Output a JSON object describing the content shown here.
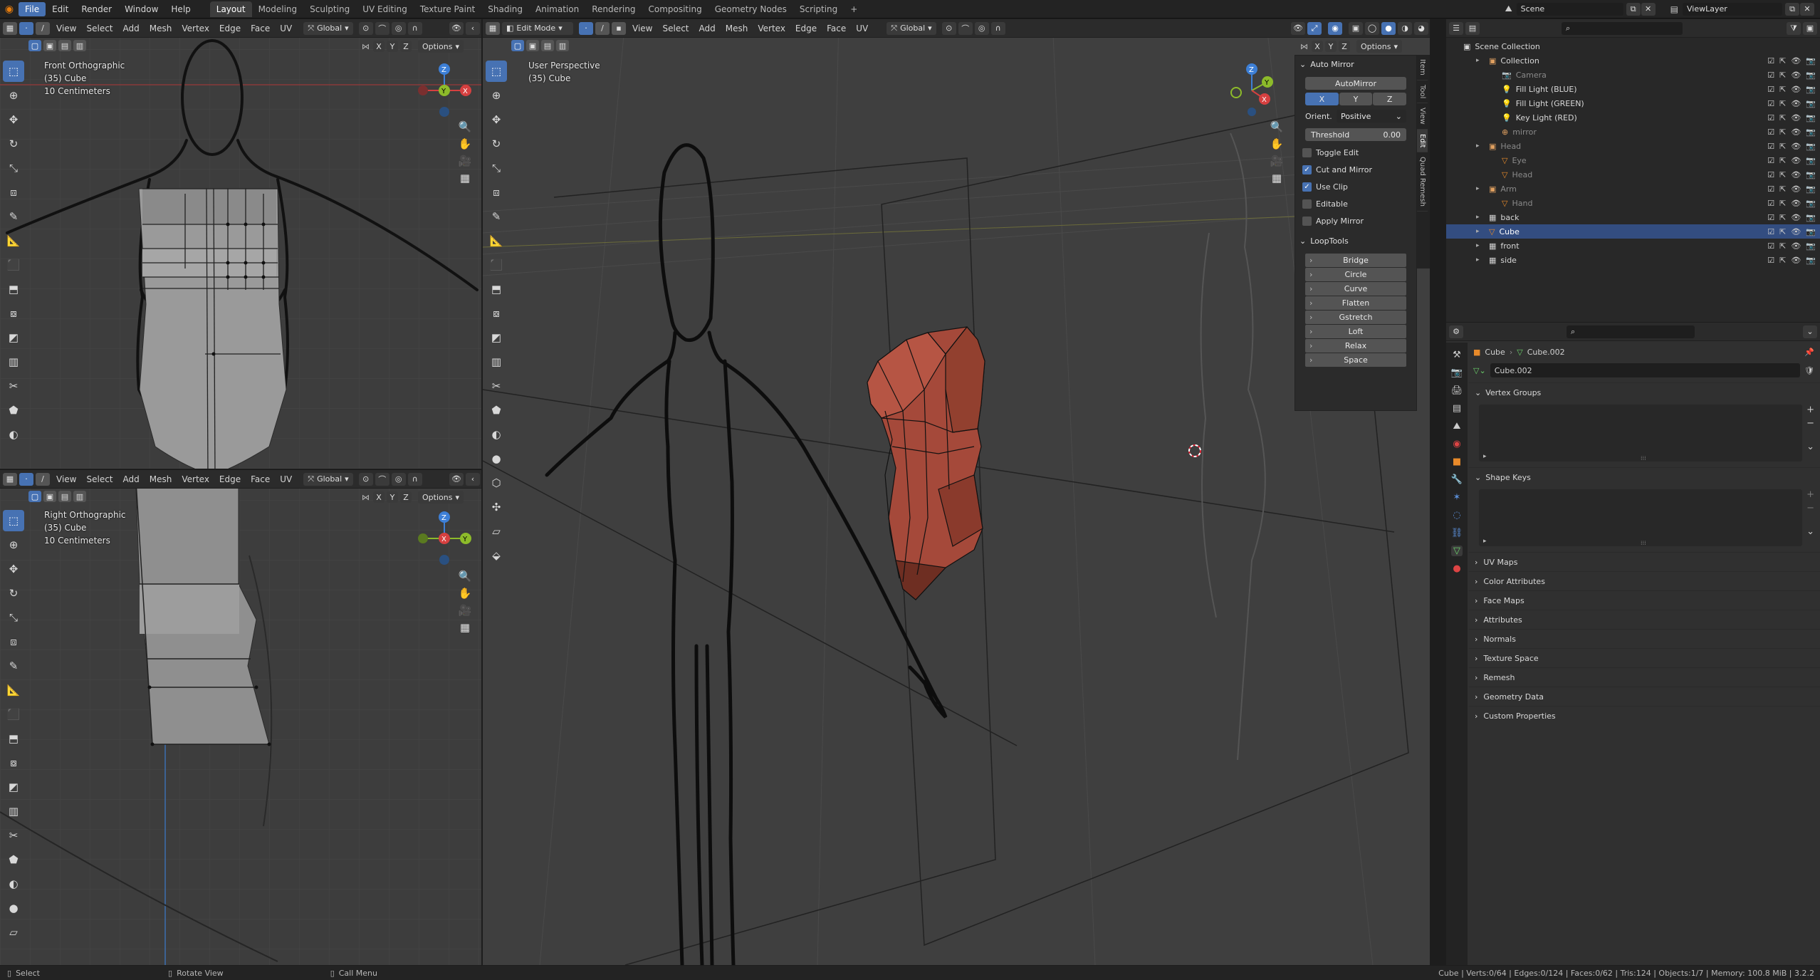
{
  "topbar": {
    "menus": [
      "File",
      "Edit",
      "Render",
      "Window",
      "Help"
    ],
    "workspaces": [
      "Layout",
      "Modeling",
      "Sculpting",
      "UV Editing",
      "Texture Paint",
      "Shading",
      "Animation",
      "Rendering",
      "Compositing",
      "Geometry Nodes",
      "Scripting"
    ],
    "add_tab": "+",
    "scene": "Scene",
    "view_layer": "ViewLayer"
  },
  "vp_front": {
    "menus": [
      "View",
      "Select",
      "Add",
      "Mesh",
      "Vertex",
      "Edge",
      "Face",
      "UV"
    ],
    "transform": "Global",
    "options": "Options",
    "axes": [
      "X",
      "Y",
      "Z"
    ],
    "overlay": [
      "Front Orthographic",
      "(35) Cube",
      "10 Centimeters"
    ]
  },
  "vp_right": {
    "menus": [
      "View",
      "Select",
      "Add",
      "Mesh",
      "Vertex",
      "Edge",
      "Face",
      "UV"
    ],
    "transform": "Global",
    "options": "Options",
    "axes": [
      "X",
      "Y",
      "Z"
    ],
    "overlay": [
      "Right Orthographic",
      "(35) Cube",
      "10 Centimeters"
    ]
  },
  "vp_main": {
    "mode": "Edit Mode",
    "menus": [
      "View",
      "Select",
      "Add",
      "Mesh",
      "Vertex",
      "Edge",
      "Face",
      "UV"
    ],
    "transform": "Global",
    "options": "Options",
    "axes": [
      "X",
      "Y",
      "Z"
    ],
    "overlay": [
      "User Perspective",
      "(35) Cube"
    ]
  },
  "auto_mirror": {
    "title": "Auto Mirror",
    "button": "AutoMirror",
    "axes": [
      "X",
      "Y",
      "Z"
    ],
    "orient_label": "Orient.",
    "orient_value": "Positive",
    "threshold_label": "Threshold",
    "threshold_value": "0.00",
    "checks": [
      {
        "label": "Toggle Edit",
        "on": false
      },
      {
        "label": "Cut and Mirror",
        "on": true
      },
      {
        "label": "Use Clip",
        "on": true
      },
      {
        "label": "Editable",
        "on": false
      },
      {
        "label": "Apply Mirror",
        "on": false
      }
    ]
  },
  "looptools": {
    "title": "LoopTools",
    "items": [
      "Bridge",
      "Circle",
      "Curve",
      "Flatten",
      "Gstretch",
      "Loft",
      "Relax",
      "Space"
    ]
  },
  "side_tabs": [
    "Item",
    "Tool",
    "View",
    "Edit",
    "Quad Remesh"
  ],
  "outliner": {
    "root": "Scene Collection",
    "rows": [
      {
        "label": "Collection",
        "indent": 1,
        "icon": "▣",
        "dim": false,
        "sel": false
      },
      {
        "label": "Camera",
        "indent": 2,
        "icon": "📷",
        "dim": true,
        "sel": false
      },
      {
        "label": "Fill Light (BLUE)",
        "indent": 2,
        "icon": "💡",
        "dim": false,
        "sel": false
      },
      {
        "label": "Fill Light (GREEN)",
        "indent": 2,
        "icon": "💡",
        "dim": false,
        "sel": false
      },
      {
        "label": "Key Light (RED)",
        "indent": 2,
        "icon": "💡",
        "dim": false,
        "sel": false
      },
      {
        "label": "mirror",
        "indent": 2,
        "icon": "⊕",
        "dim": true,
        "sel": false
      },
      {
        "label": "Head",
        "indent": 1,
        "icon": "▣",
        "dim": true,
        "sel": false
      },
      {
        "label": "Eye",
        "indent": 2,
        "icon": "▽",
        "dim": true,
        "sel": false
      },
      {
        "label": "Head",
        "indent": 2,
        "icon": "▽",
        "dim": true,
        "sel": false
      },
      {
        "label": "Arm",
        "indent": 1,
        "icon": "▣",
        "dim": true,
        "sel": false
      },
      {
        "label": "Hand",
        "indent": 2,
        "icon": "▽",
        "dim": true,
        "sel": false
      },
      {
        "label": "back",
        "indent": 1,
        "icon": "▦",
        "dim": false,
        "sel": false
      },
      {
        "label": "Cube",
        "indent": 1,
        "icon": "▽",
        "dim": false,
        "sel": true
      },
      {
        "label": "front",
        "indent": 1,
        "icon": "▦",
        "dim": false,
        "sel": false
      },
      {
        "label": "side",
        "indent": 1,
        "icon": "▦",
        "dim": false,
        "sel": false
      }
    ]
  },
  "properties": {
    "breadcrumb_obj": "Cube",
    "breadcrumb_sep": "›",
    "breadcrumb_data": "Cube.002",
    "data_name": "Cube.002",
    "sections_open": [
      "Vertex Groups",
      "Shape Keys"
    ],
    "sections": [
      "UV Maps",
      "Color Attributes",
      "Face Maps",
      "Attributes",
      "Normals",
      "Texture Space",
      "Remesh",
      "Geometry Data",
      "Custom Properties"
    ]
  },
  "status": {
    "select": "Select",
    "rotate": "Rotate View",
    "menu": "Call Menu",
    "stats": "Cube | Verts:0/64 | Edges:0/124 | Faces:0/62 | Tris:124 | Objects:1/7 | Memory: 100.8 MiB | 3.2.2"
  },
  "colors": {
    "accent": "#4772b3",
    "mesh": "#a5493a",
    "selected_row": "#334d80"
  }
}
